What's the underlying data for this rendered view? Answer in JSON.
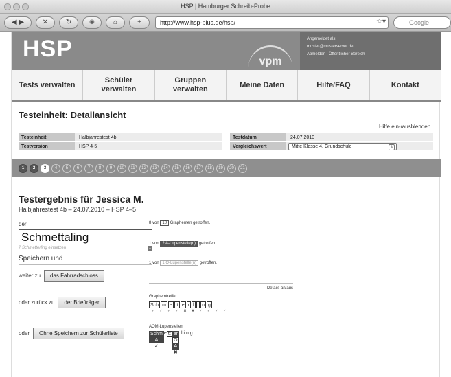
{
  "browser": {
    "title": "HSP | Hamburger Schreib-Probe",
    "url": "http://www.hsp-plus.de/hsp/",
    "search_placeholder": "Google",
    "star": "☆▾"
  },
  "header": {
    "logo": "HSP",
    "vpm_logo": "vpm",
    "login_label": "Angemeldet als:",
    "login_user": "muster@musterserver.de",
    "login_links": "Abmelden | Öffentlicher Bereich"
  },
  "nav": [
    {
      "label": "Tests verwalten"
    },
    {
      "label": "Schüler\nverwalten"
    },
    {
      "label": "Gruppen\nverwalten"
    },
    {
      "label": "Meine Daten"
    },
    {
      "label": "Hilfe/FAQ"
    },
    {
      "label": "Kontakt"
    }
  ],
  "page_title": "Testeinheit: Detailansicht",
  "help_toggle": "Hilfe ein-/ausblenden",
  "info": {
    "testeinheit_label": "Testeinheit",
    "testeinheit_value": "Halbjahrestest 4b",
    "testversion_label": "Testversion",
    "testversion_value": "HSP 4-5",
    "testdatum_label": "Testdatum",
    "testdatum_value": "24.07.2010",
    "vergleich_label": "Vergleichswert",
    "vergleich_value": "Mitte Klasse 4, Grundschule",
    "vergleich_arrow": "⇕"
  },
  "pager": {
    "pages": [
      "1",
      "2",
      "3",
      "4",
      "5",
      "6",
      "7",
      "8",
      "9",
      "10",
      "11",
      "12",
      "13",
      "14",
      "15",
      "16",
      "17",
      "18",
      "19",
      "20",
      "21"
    ],
    "done_count": 2,
    "current": 3
  },
  "result": {
    "title": "Testergebnis für Jessica M.",
    "subtitle": "Halbjahrestest 4b – 24.07.2010 – HSP 4–5",
    "article": "der",
    "word": "Schmettaling",
    "hint": "? Schmetterling einsetzen",
    "hint_close": "x",
    "save_heading": "Speichern und",
    "next_label": "weiter zu",
    "next_button": "das Fahrradschloss",
    "back_label": "oder zurück zu",
    "back_button": "der Briefträger",
    "no_save_label": "oder",
    "no_save_button": "Ohne Speichern zur Schülerliste"
  },
  "stats": {
    "grapheme_prefix": "8 von",
    "grapheme_count": "10",
    "grapheme_suffix": "Graphemen getroffen.",
    "a_prefix": "1 von",
    "a_box": "2 A-Lupenstelle(n)",
    "a_suffix": "getroffen.",
    "o_prefix": "1 von",
    "o_box": "1 O-Lupenstelle(n)",
    "o_suffix": "getroffen.",
    "details_toggle": "Details an/aus",
    "grapheme_heading": "Graphemtreffer",
    "graphemes": [
      "Sch",
      "m",
      "e",
      "tt",
      "e",
      "r",
      "l",
      "i",
      "n",
      "g"
    ],
    "grapheme_marks": "✓ ✓ ✓ ✓ ✖ ✖ ✓ ✓ ✓ ✓",
    "aom_heading": "AOM-Lupenstellen",
    "aom_first": "Schm",
    "aom_first_sub": "A",
    "aom_e": "e",
    "aom_tt": "tt",
    "aom_er": "er",
    "aom_er_sub1": "O",
    "aom_er_sub2": "A",
    "aom_ling": "l i n g",
    "aom_mark_ok": "✓",
    "aom_mark_x": "✖"
  }
}
